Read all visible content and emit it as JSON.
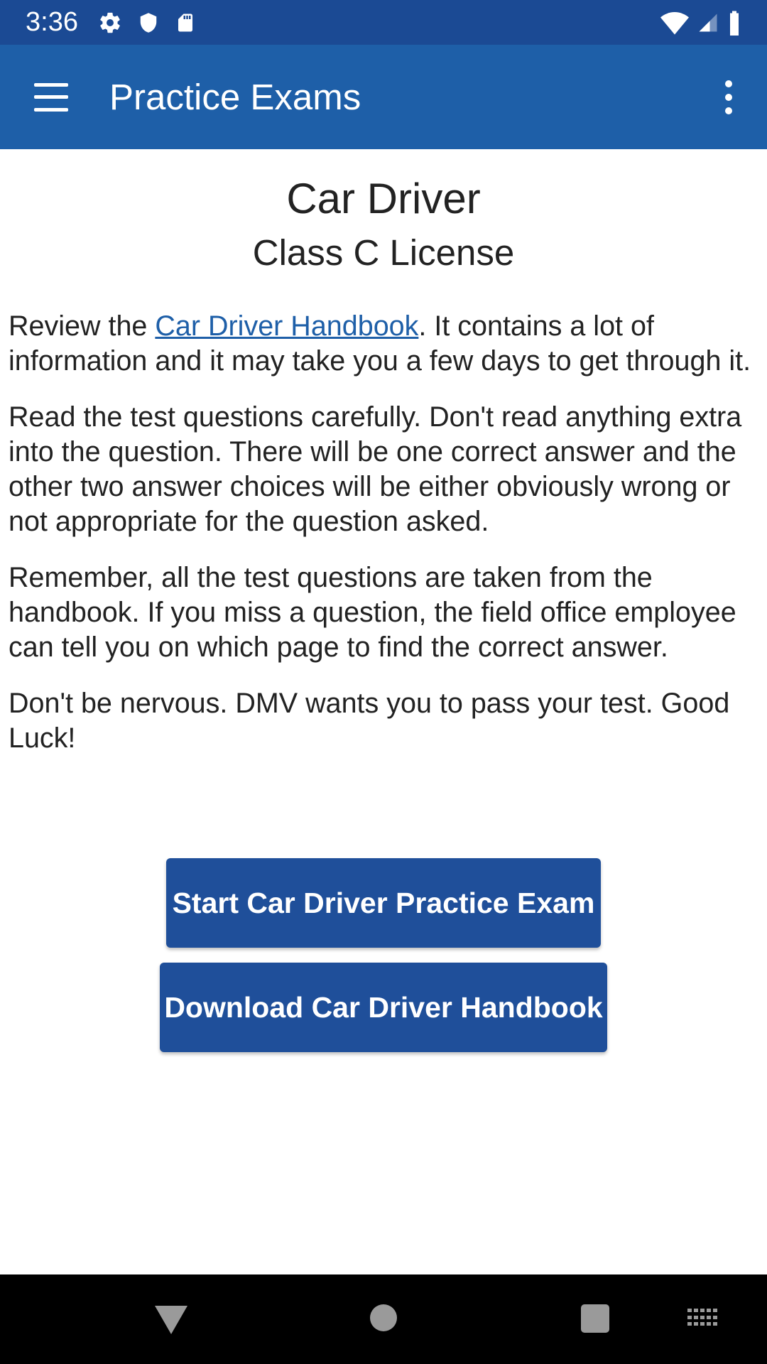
{
  "status_bar": {
    "time": "3:36",
    "icons_left": [
      "settings-icon",
      "shield-icon",
      "sd-card-icon"
    ],
    "icons_right": [
      "wifi-icon",
      "signal-icon",
      "battery-icon"
    ]
  },
  "app_bar": {
    "title": "Practice Exams",
    "menu_icon": "hamburger-menu-icon",
    "overflow_icon": "more-vert-icon",
    "color": "#1e5fa8"
  },
  "content": {
    "title": "Car Driver",
    "subtitle": "Class C License",
    "para1_before": "Review the ",
    "para1_link": "Car Driver Handbook",
    "para1_after": ". It contains a lot of information and it may take you a few days to get through it.",
    "para2": "Read the test questions carefully. Don't read anything extra into the question. There will be one correct answer and the other two answer choices will be either obviously wrong or not appropriate for the question asked.",
    "para3": "Remember, all the test questions are taken from the handbook. If you miss a question, the field office employee can tell you on which page to find the correct answer.",
    "para4": "Don't be nervous. DMV wants you to pass your test. Good Luck!"
  },
  "buttons": {
    "start_exam": "Start Car Driver Practice Exam",
    "download_handbook": "Download Car Driver Handbook",
    "color": "#1f4f9a"
  },
  "nav_bar": {
    "icons": [
      "back-icon",
      "home-icon",
      "recents-icon",
      "keyboard-icon"
    ]
  }
}
